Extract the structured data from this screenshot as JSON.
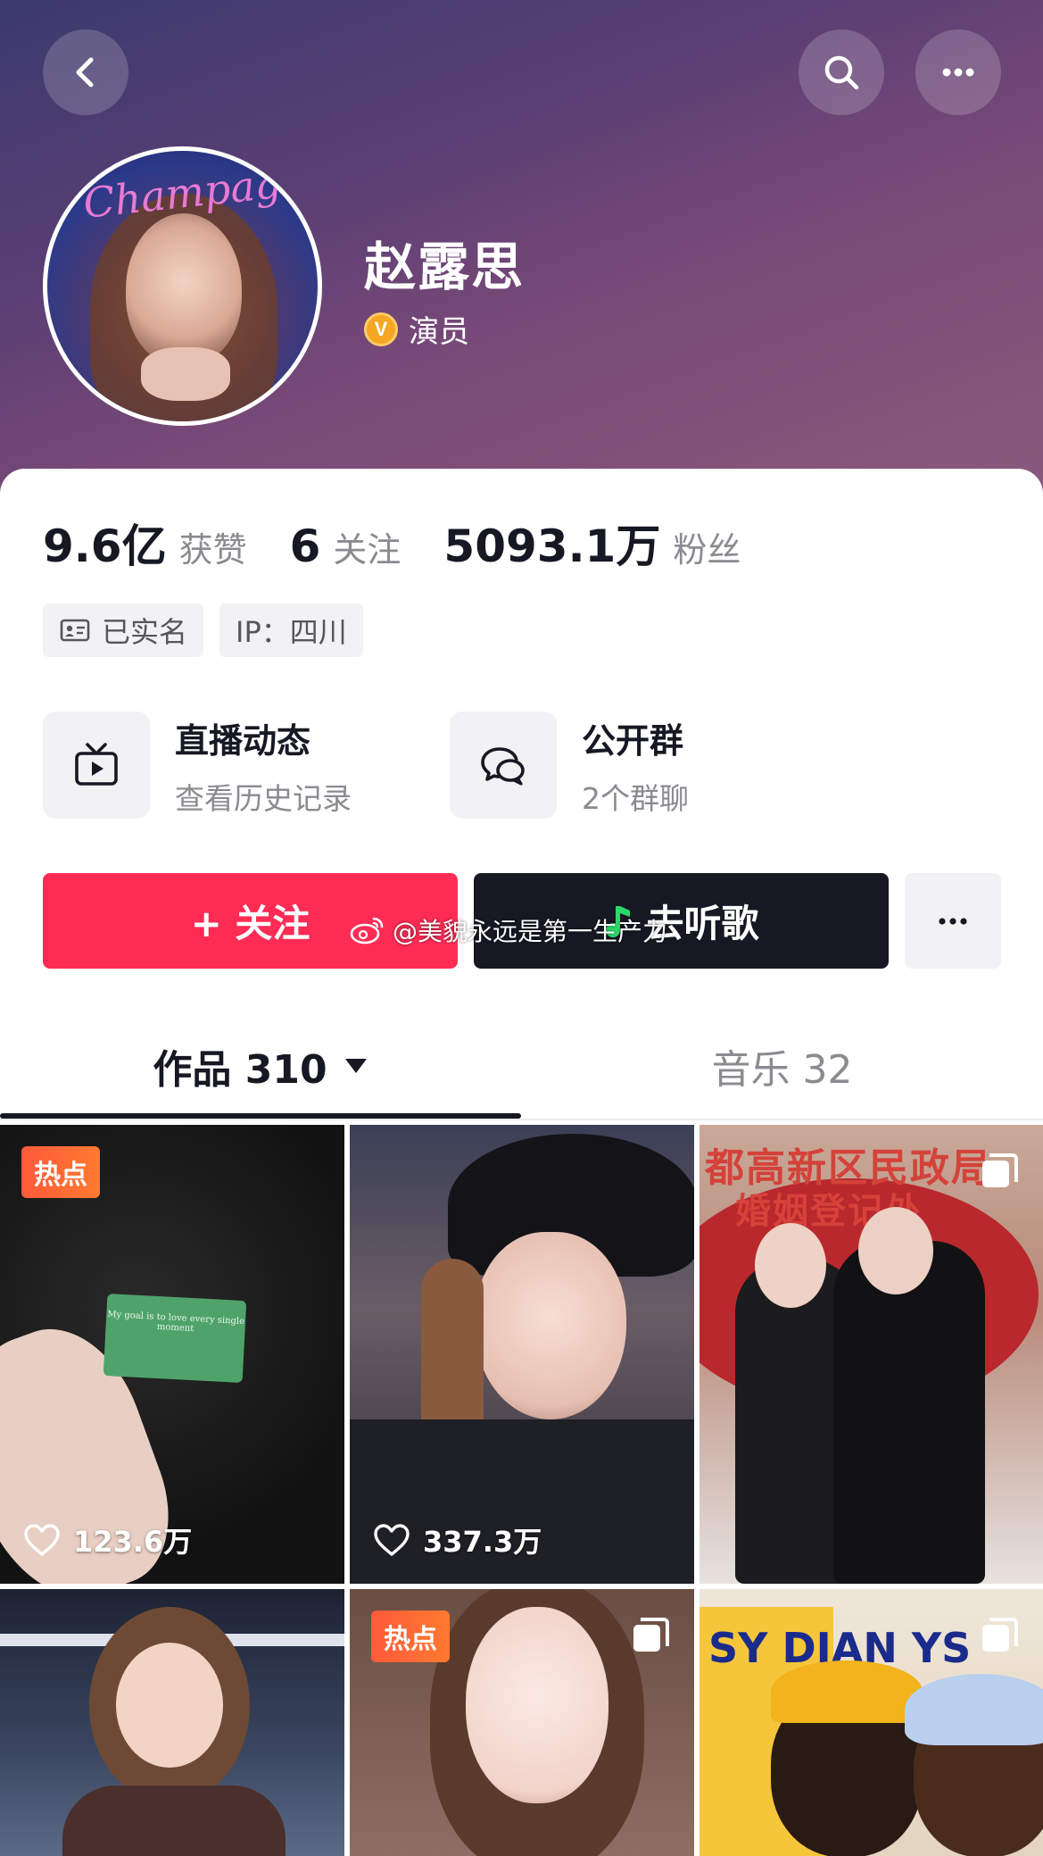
{
  "profile": {
    "name": "赵露思",
    "verify_badge": "V",
    "verify_label": "演员",
    "avatar_text": "Champagne"
  },
  "stats": {
    "likes_count": "9.6亿",
    "likes_label": "获赞",
    "following_count": "6",
    "following_label": "关注",
    "followers_count": "5093.1万",
    "followers_label": "粉丝"
  },
  "tags": {
    "realname": "已实名",
    "ip": "IP：四川"
  },
  "entries": {
    "live_title": "直播动态",
    "live_sub": "查看历史记录",
    "group_title": "公开群",
    "group_sub": "2个群聊"
  },
  "actions": {
    "follow_label": "+ 关注",
    "listen_label": "去听歌"
  },
  "watermark": "@美貌永远是第一生产力",
  "tabs": {
    "works_label": "作品 310",
    "music_label": "音乐 32"
  },
  "grid": {
    "hot_badge": "热点",
    "item1_likes": "123.6万",
    "item2_likes": "337.3万",
    "item1_card_text": "My goal is to love every single moment",
    "item3_sign": "都高新区民政局",
    "item3_sign2": "婚姻登记处",
    "item6_toy_text": "SY DIAN YS"
  },
  "colors": {
    "accent_red": "#fe2c55",
    "dark_button": "#161823",
    "verify_gold": "#f5a623",
    "hot_badge": "#ff5a3c"
  },
  "icons": [
    "back-arrow-icon",
    "search-icon",
    "more-dots-icon",
    "verify-v-icon",
    "id-card-icon",
    "tv-icon",
    "chat-bubbles-icon",
    "music-note-icon",
    "weibo-icon",
    "dropdown-triangle-icon",
    "heart-icon",
    "multi-image-icon"
  ]
}
